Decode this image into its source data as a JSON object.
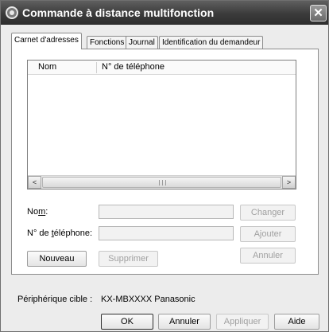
{
  "window": {
    "title": "Commande à distance multifonction",
    "close_glyph": "✕"
  },
  "tabs": [
    {
      "label": "Carnet d'adresses",
      "active": true
    },
    {
      "label": "Fonctions",
      "active": false
    },
    {
      "label": "Journal",
      "active": false
    },
    {
      "label": "Identification du demandeur",
      "active": false
    }
  ],
  "list": {
    "columns": [
      "Nom",
      "N° de téléphone"
    ],
    "rows": [],
    "scroll_left": "<",
    "scroll_right": ">"
  },
  "form": {
    "name_label_pre": "No",
    "name_label_ul": "m",
    "name_label_post": ":",
    "phone_label_pre": "N° de ",
    "phone_label_ul": "t",
    "phone_label_post": "éléphone:",
    "name_value": "",
    "phone_value": ""
  },
  "buttons": {
    "changer": "Changer",
    "ajouter": "Ajouter",
    "annuler_entry": "Annuler",
    "nouveau": "Nouveau",
    "supprimer": "Supprimer",
    "ok": "OK",
    "annuler": "Annuler",
    "appliquer": "Appliquer",
    "aide": "Aide"
  },
  "footer": {
    "device_label": "Périphérique cible :",
    "device_value": "KX-MBXXXX Panasonic"
  }
}
